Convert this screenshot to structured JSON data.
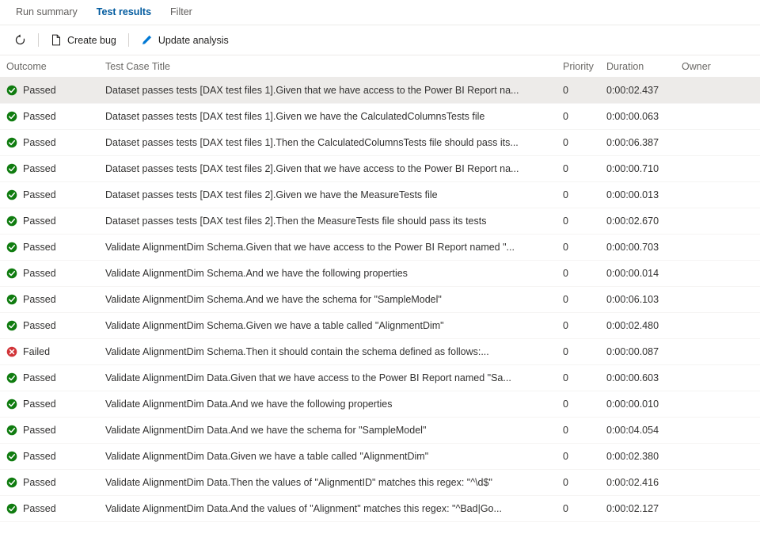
{
  "tabs": [
    {
      "label": "Run summary",
      "active": false
    },
    {
      "label": "Test results",
      "active": true
    },
    {
      "label": "Filter",
      "active": false
    }
  ],
  "toolbar": {
    "refresh_label": "",
    "refresh_icon": "refresh-icon",
    "create_bug_label": "Create bug",
    "create_bug_icon": "document-icon",
    "update_analysis_label": "Update analysis",
    "update_analysis_icon": "pencil-icon"
  },
  "colors": {
    "accent": "#005a9e",
    "passed": "#107c10",
    "failed": "#d13438",
    "selected_row": "#edebe9",
    "pencil": "#0078d4"
  },
  "table": {
    "columns": {
      "outcome": "Outcome",
      "title": "Test Case Title",
      "priority": "Priority",
      "duration": "Duration",
      "owner": "Owner"
    },
    "rows": [
      {
        "outcome": "Passed",
        "status": "passed",
        "title": "Dataset passes tests [DAX test files 1].Given that we have access to the Power BI Report na...",
        "priority": "0",
        "duration": "0:00:02.437",
        "owner": "",
        "selected": true
      },
      {
        "outcome": "Passed",
        "status": "passed",
        "title": "Dataset passes tests [DAX test files 1].Given we have the CalculatedColumnsTests file",
        "priority": "0",
        "duration": "0:00:00.063",
        "owner": "",
        "selected": false
      },
      {
        "outcome": "Passed",
        "status": "passed",
        "title": "Dataset passes tests [DAX test files 1].Then the CalculatedColumnsTests file should pass its...",
        "priority": "0",
        "duration": "0:00:06.387",
        "owner": "",
        "selected": false
      },
      {
        "outcome": "Passed",
        "status": "passed",
        "title": "Dataset passes tests [DAX test files 2].Given that we have access to the Power BI Report na...",
        "priority": "0",
        "duration": "0:00:00.710",
        "owner": "",
        "selected": false
      },
      {
        "outcome": "Passed",
        "status": "passed",
        "title": "Dataset passes tests [DAX test files 2].Given we have the MeasureTests file",
        "priority": "0",
        "duration": "0:00:00.013",
        "owner": "",
        "selected": false
      },
      {
        "outcome": "Passed",
        "status": "passed",
        "title": "Dataset passes tests [DAX test files 2].Then the MeasureTests file should pass its tests",
        "priority": "0",
        "duration": "0:00:02.670",
        "owner": "",
        "selected": false
      },
      {
        "outcome": "Passed",
        "status": "passed",
        "title": "Validate AlignmentDim Schema.Given that we have access to the Power BI Report named \"...",
        "priority": "0",
        "duration": "0:00:00.703",
        "owner": "",
        "selected": false
      },
      {
        "outcome": "Passed",
        "status": "passed",
        "title": "Validate AlignmentDim Schema.And we have the following properties",
        "priority": "0",
        "duration": "0:00:00.014",
        "owner": "",
        "selected": false
      },
      {
        "outcome": "Passed",
        "status": "passed",
        "title": "Validate AlignmentDim Schema.And we have the schema for \"SampleModel\"",
        "priority": "0",
        "duration": "0:00:06.103",
        "owner": "",
        "selected": false
      },
      {
        "outcome": "Passed",
        "status": "passed",
        "title": "Validate AlignmentDim Schema.Given we have a table called \"AlignmentDim\"",
        "priority": "0",
        "duration": "0:00:02.480",
        "owner": "",
        "selected": false
      },
      {
        "outcome": "Failed",
        "status": "failed",
        "title": "Validate AlignmentDim Schema.Then it should contain the schema defined as follows:...",
        "priority": "0",
        "duration": "0:00:00.087",
        "owner": "",
        "selected": false
      },
      {
        "outcome": "Passed",
        "status": "passed",
        "title": "Validate AlignmentDim Data.Given that we have access to the Power BI Report named \"Sa...",
        "priority": "0",
        "duration": "0:00:00.603",
        "owner": "",
        "selected": false
      },
      {
        "outcome": "Passed",
        "status": "passed",
        "title": "Validate AlignmentDim Data.And we have the following properties",
        "priority": "0",
        "duration": "0:00:00.010",
        "owner": "",
        "selected": false
      },
      {
        "outcome": "Passed",
        "status": "passed",
        "title": "Validate AlignmentDim Data.And we have the schema for \"SampleModel\"",
        "priority": "0",
        "duration": "0:00:04.054",
        "owner": "",
        "selected": false
      },
      {
        "outcome": "Passed",
        "status": "passed",
        "title": "Validate AlignmentDim Data.Given we have a table called \"AlignmentDim\"",
        "priority": "0",
        "duration": "0:00:02.380",
        "owner": "",
        "selected": false
      },
      {
        "outcome": "Passed",
        "status": "passed",
        "title": "Validate AlignmentDim Data.Then the values of \"AlignmentID\" matches this regex: \"^\\d$\"",
        "priority": "0",
        "duration": "0:00:02.416",
        "owner": "",
        "selected": false
      },
      {
        "outcome": "Passed",
        "status": "passed",
        "title": "Validate AlignmentDim Data.And the values of \"Alignment\" matches this regex: \"^Bad|Go...",
        "priority": "0",
        "duration": "0:00:02.127",
        "owner": "",
        "selected": false
      }
    ]
  }
}
